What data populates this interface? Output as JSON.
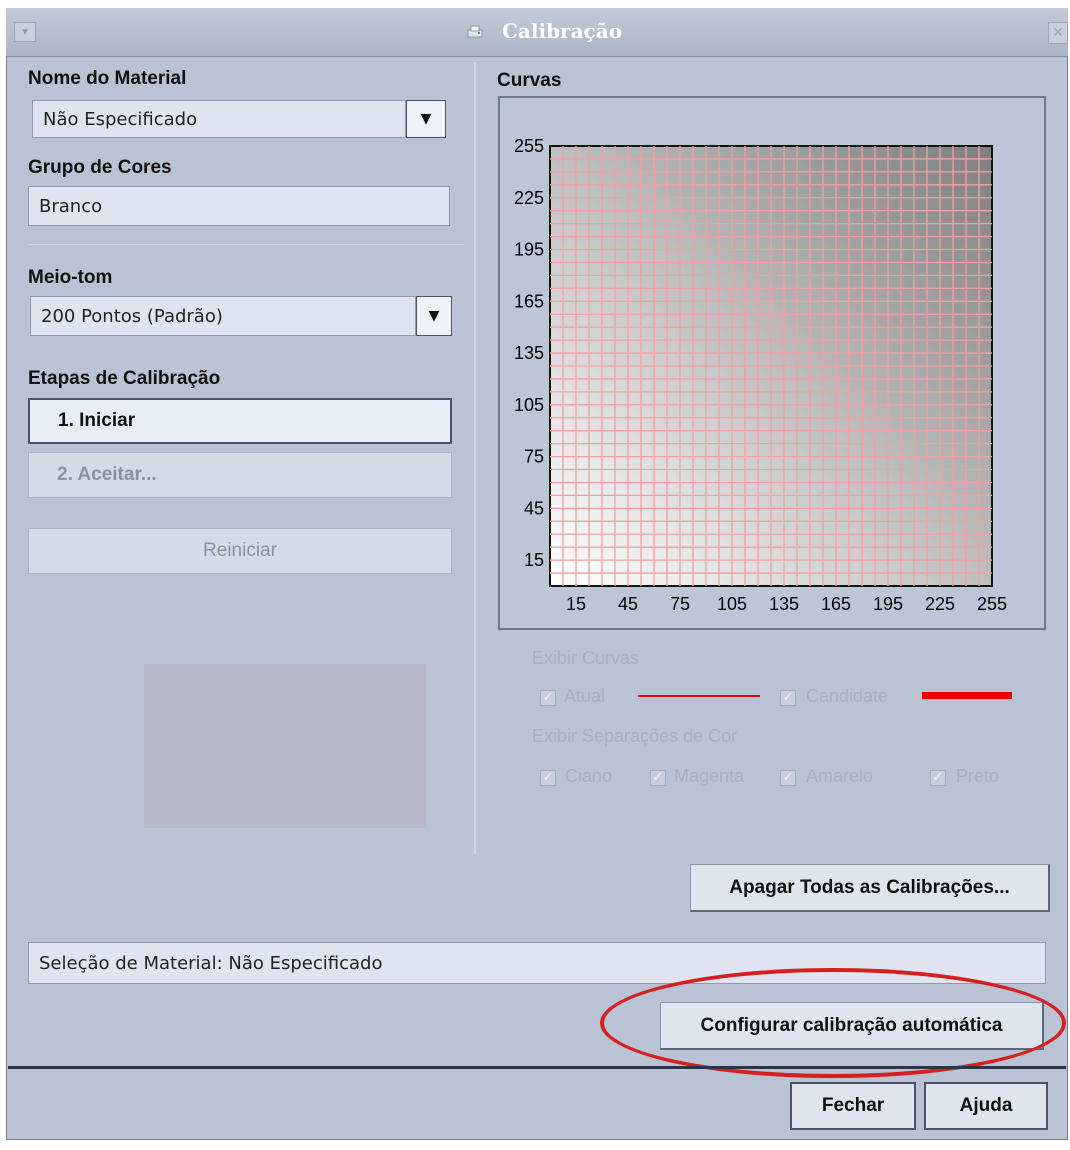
{
  "window": {
    "title": "Calibração",
    "app_icon": "printer-icon",
    "menu_icon": "window-menu-icon",
    "close_icon": "close-icon"
  },
  "left": {
    "material_label": "Nome do Material",
    "material_value": "Não Especificado",
    "color_group_label": "Grupo de Cores",
    "color_group_value": "Branco",
    "halftone_label": "Meio-tom",
    "halftone_value": "200 Pontos (Padrão)",
    "steps_label": "Etapas de Calibração",
    "step1": "1. Iniciar",
    "step2": "2. Aceitar...",
    "reset": "Reiniciar"
  },
  "curves": {
    "label": "Curvas",
    "show_curves_label": "Exibir Curvas",
    "current": "Atual",
    "candidate": "Candidate",
    "show_separations_label": "Exibir Separações de Cor",
    "cyan": "Ciano",
    "magenta": "Magenta",
    "yellow": "Amarelo",
    "black": "Preto",
    "curve_color": "#ee0000",
    "grid_color": "#f2a0a0"
  },
  "chart_data": {
    "type": "line",
    "x_ticks": [
      15,
      45,
      75,
      105,
      135,
      165,
      195,
      225,
      255
    ],
    "y_ticks": [
      255,
      225,
      195,
      165,
      135,
      105,
      75,
      45,
      15
    ],
    "xlim": [
      0,
      255
    ],
    "ylim": [
      0,
      255
    ],
    "grid": true,
    "series": []
  },
  "buttons": {
    "delete_all": "Apagar Todas as Calibrações...",
    "auto_calibration": "Configurar calibração automática",
    "close": "Fechar",
    "help": "Ajuda"
  },
  "status": {
    "material_selection": "Seleção de Material: Não Especificado"
  },
  "annotation": {
    "highlight_color": "#d42020"
  }
}
